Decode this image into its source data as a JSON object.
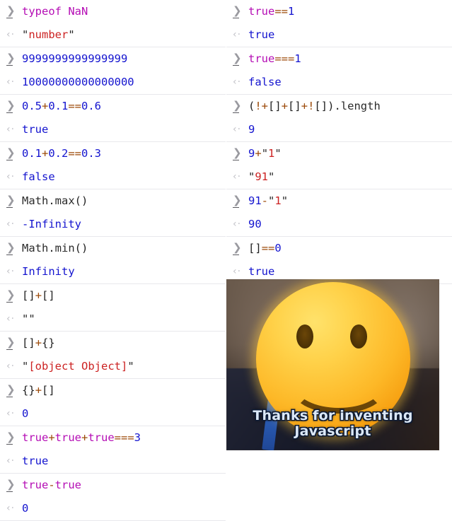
{
  "app": {
    "name": "browser-javascript-console",
    "title": "JavaScript Console",
    "background": "#ffffff",
    "divider_color": "#e8e8ec"
  },
  "prompts": {
    "input_marker": "❯",
    "output_marker": "‹"
  },
  "colors": {
    "number": "#1414cf",
    "operator": "#9c4a09",
    "keyword": "#b50eb5",
    "string": "#cc2222",
    "plain": "#2b2b2b",
    "prompt_in": "#9a9aa0",
    "prompt_out": "#c2c2c8",
    "caption_text": "#dbe8f7",
    "emoji_yellow": "#fdb827"
  },
  "columns": {
    "left": [
      {
        "input": "typeof NaN",
        "output": "\"number\""
      },
      {
        "input": "9999999999999999",
        "output": "10000000000000000"
      },
      {
        "input": "0.5+0.1==0.6",
        "output": "true"
      },
      {
        "input": "0.1+0.2==0.3",
        "output": "false"
      },
      {
        "input": "Math.max()",
        "output": "-Infinity"
      },
      {
        "input": "Math.min()",
        "output": "Infinity"
      },
      {
        "input": "[]+[]",
        "output": "\"\""
      },
      {
        "input": "[]+{}",
        "output": "\"[object Object]\""
      },
      {
        "input": "{}+[]",
        "output": "0"
      },
      {
        "input": "true+true+true===3",
        "output": "true"
      },
      {
        "input": "true-true",
        "output": "0"
      }
    ],
    "right": [
      {
        "input": "true==1",
        "output": "true"
      },
      {
        "input": "true===1",
        "output": "false"
      },
      {
        "input": "(!+[]+[]+![]).length",
        "output": "9"
      },
      {
        "input": "9+\"1\"",
        "output": "\"91\""
      },
      {
        "input": "91-\"1\"",
        "output": "90"
      },
      {
        "input": "[]==0",
        "output": "true"
      }
    ]
  },
  "meme": {
    "name": "thanks-for-inventing-javascript-meme",
    "caption": "Thanks for inventing Javascript",
    "emoji": "slightly-smiling-face"
  }
}
